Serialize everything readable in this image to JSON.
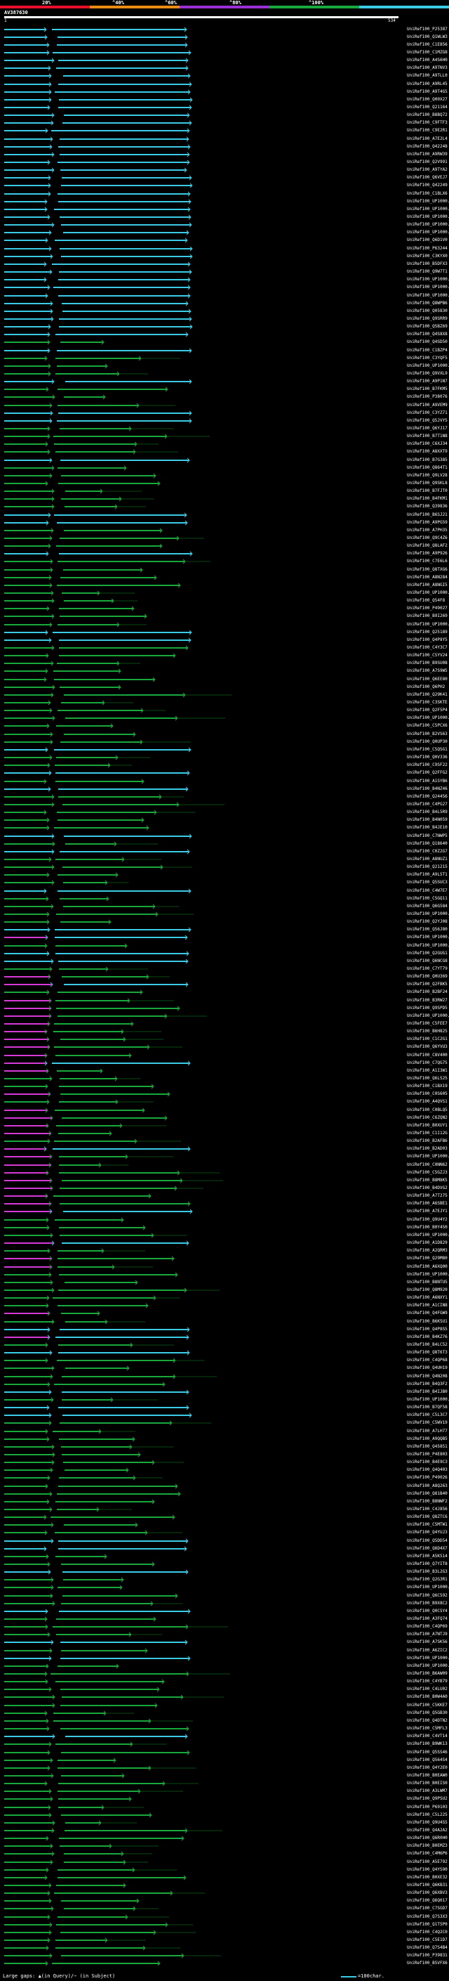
{
  "legend": {
    "ticks": [
      "20%",
      "^40%",
      "^60%",
      "^80%",
      "^100%"
    ],
    "colors": [
      "#e8102a",
      "#e98c14",
      "#9b2fd6",
      "#19a83b",
      "#3ccbe6"
    ]
  },
  "query": {
    "title": "AV387630",
    "start": "1",
    "end": "534"
  },
  "footer": {
    "large_gaps": "Large gaps: ▲(in Query)/− (in Subject)",
    "scale": "=100char."
  },
  "hits": [
    "UniRef100_P25387",
    "UniRef100_Q1WLW3",
    "UniRef100_C1E856",
    "UniRef100_C1MZG8",
    "UniRef100_A4S6H0",
    "UniRef100_A9TNV3",
    "UniRef100_A9TLL0",
    "UniRef100_A9RL45",
    "UniRef100_A9T4G5",
    "UniRef100_Q00X27",
    "UniRef100_Q21164",
    "UniRef100_B8BQ72",
    "UniRef100_C9FTF3",
    "UniRef100_C9E2R1",
    "UniRef100_A7E2L4",
    "UniRef100_Q42248",
    "UniRef100_A9RW39",
    "UniRef100_Q2V991",
    "UniRef100_A9TYA2",
    "UniRef100_Q6VEJ7",
    "UniRef100_Q42249",
    "UniRef100_C1BLX6",
    "UniRef100_UP1000..",
    "UniRef100_UP1000..",
    "UniRef100_UP1000..",
    "UniRef100_UP1000..",
    "UniRef100_UP1000..",
    "UniRef100_Q6D1V0",
    "UniRef100_P63244",
    "UniRef100_C3KYX0",
    "UniRef100_B5DFX3",
    "UniRef100_Q9W7T1",
    "UniRef100_UP1000..",
    "UniRef100_UP1000..",
    "UniRef100_UP1000..",
    "UniRef100_Q8WPB6",
    "UniRef100_Q05830",
    "UniRef100_Q9SRR9",
    "UniRef100_Q5BZ69",
    "UniRef100_Q4S8X8",
    "UniRef100_Q4SD50",
    "UniRef100_C1BZP4",
    "UniRef100_C3YQF5",
    "UniRef100_UP1000..",
    "UniRef100_Q9VXL9",
    "UniRef100_A9P1N7",
    "UniRef100_B7FKM5",
    "UniRef100_P38076",
    "UniRef100_A9VEM9",
    "UniRef100_C3YZ71",
    "UniRef100_Q5JVY5",
    "UniRef100_Q6YJ17",
    "UniRef100_B7T1N8",
    "UniRef100_C6XJ34",
    "UniRef100_A8XXT9",
    "UniRef100_B7G385",
    "UniRef100_Q864T1",
    "UniRef100_Q9LV28",
    "UniRef100_Q9SKL8",
    "UniRef100_B7FJT0",
    "UniRef100_B4FKM1",
    "UniRef100_Q39836",
    "UniRef100_B6SJ21",
    "UniRef100_A9PG59",
    "UniRef100_A7PH35",
    "UniRef100_Q9C4Z6",
    "UniRef100_Q8LAF2",
    "UniRef100_A9P926",
    "UniRef100_C7E6L6",
    "UniRef100_Q8TXG6",
    "UniRef100_A8N284",
    "UniRef100_A8NGI5",
    "UniRef100_UP1000..",
    "UniRef100_Q54F8",
    "UniRef100_P49027",
    "UniRef100_B9I269",
    "UniRef100_UP1000..",
    "UniRef100_Q25189",
    "UniRef100_Q4P8Y5",
    "UniRef100_C4Y3C7",
    "UniRef100_C5YV24",
    "UniRef100_B9SU08",
    "UniRef100_A7S9W5",
    "UniRef100_Q6EE80",
    "UniRef100_Q6PH2",
    "UniRef100_Q29K41",
    "UniRef100_C3SKTE",
    "UniRef100_Q2F5P4",
    "UniRef100_UP1000..",
    "UniRef100_C5PCX6",
    "UniRef100_B2VS63",
    "UniRef100_Q0UP30",
    "UniRef100_C5QSG1",
    "UniRef100_Q0V336",
    "UniRef100_C9SF22",
    "UniRef100_Q2FFG2",
    "UniRef100_A1SYB6",
    "UniRef100_B4NZ46",
    "UniRef100_Q24456",
    "UniRef100_C4PG27",
    "UniRef100_B4L5R9",
    "UniRef100_B4N059",
    "UniRef100_B4JE10",
    "UniRef100_C7NWP5",
    "UniRef100_Q18640",
    "UniRef100_C0Z2G7",
    "UniRef100_A8NUZ1",
    "UniRef100_Q21215",
    "UniRef100_A9LST1",
    "UniRef100_Q5SUC3",
    "UniRef100_C4W7E7",
    "UniRef100_C5GQ11",
    "UniRef100_Q6G584",
    "UniRef100_UP1000..",
    "UniRef100_Q2YJ08",
    "UniRef100_Q56J80",
    "UniRef100_UP1000..",
    "UniRef100_UP1000..",
    "UniRef100_Q2GUG1",
    "UniRef100_Q6NCG8",
    "UniRef100_C7YT79",
    "UniRef100_Q0U369",
    "UniRef100_Q2FBK5",
    "UniRef100_B2BF24",
    "UniRef100_B3RW27",
    "UniRef100_Q9SPD5",
    "UniRef100_UP1000..",
    "UniRef100_C5FEE7",
    "UniRef100_B6H825",
    "UniRef100_C1C2G1",
    "UniRef100_Q6YVU3",
    "UniRef100_C8V400",
    "UniRef100_C7QG75",
    "UniRef100_A1I3W1",
    "UniRef100_Q6LS25",
    "UniRef100_C1BX19",
    "UniRef100_C0S605",
    "UniRef100_A4QVS1",
    "UniRef100_C0BLQ5",
    "UniRef100_C6ZQN2",
    "UniRef100_B0XUY1",
    "UniRef100_C1I12G",
    "UniRef100_B2AFB6",
    "UniRef100_B2AD03",
    "UniRef100_UP1000..",
    "UniRef100_C0NN62",
    "UniRef100_C5GZJ3",
    "UniRef100_B8M8K5",
    "UniRef100_B4DVG2",
    "UniRef100_A7T275",
    "UniRef100_A6SBE1",
    "UniRef100_A7EJY1",
    "UniRef100_Q9U4Y2",
    "UniRef100_B0Y450",
    "UniRef100_UP1000..",
    "UniRef100_A1D829",
    "UniRef100_A2QRM3",
    "UniRef100_Q29M80",
    "UniRef100_A6XQ00",
    "UniRef100_UP1000..",
    "UniRef100_B8NTU5",
    "UniRef100_Q8M920",
    "UniRef100_A6NXY1",
    "UniRef100_A1CIN8",
    "UniRef100_Q4FGW9",
    "UniRef100_B6K5U1",
    "UniRef100_Q4P8S5",
    "UniRef100_B4KZ76",
    "UniRef100_B4LC52",
    "UniRef100_Q8T6T3",
    "UniRef100_C4QP68",
    "UniRef100_Q4UH19",
    "UniRef100_Q4N208",
    "UniRef100_B4Q3F2",
    "UniRef100_B4IJB0",
    "UniRef100_UP1000..",
    "UniRef100_B7QF58",
    "UniRef100_C5L3C7",
    "UniRef100_C5WV19",
    "UniRef100_A7LH77",
    "UniRef100_A9QQB5",
    "UniRef100_Q45851",
    "UniRef100_P4E803",
    "UniRef100_B4E9C3",
    "UniRef100_Q4Q403",
    "UniRef100_P49026",
    "UniRef100_A8Q263",
    "UniRef100_Q81B40",
    "UniRef100_B8NWF2",
    "UniRef100_C4J856",
    "UniRef100_Q8ZTC6",
    "UniRef100_C5MTW1",
    "UniRef100_Q4YUJ3",
    "UniRef100_Q5DD54",
    "UniRef100_Q6D4X7",
    "UniRef100_A5K514",
    "UniRef100_Q7YIT8",
    "UniRef100_B3L2G3",
    "UniRef100_Q2G3R1",
    "UniRef100_UP1000..",
    "UniRef100_Q6C592",
    "UniRef100_B9X8C2",
    "UniRef100_Q0CSY4",
    "UniRef100_A3FQ74",
    "UniRef100_C4QP69",
    "UniRef100_A7NTJ9",
    "UniRef100_A7SK56",
    "UniRef100_A6ZIC2",
    "UniRef100_UP1000..",
    "UniRef100_UP1000..",
    "UniRef100_B6AW09",
    "UniRef100_C4YB79",
    "UniRef100_C4LU02",
    "UniRef100_B0W4A0",
    "UniRef100_C5KKE7",
    "UniRef100_Q5GB30",
    "UniRef100_Q4DTN2",
    "UniRef100_C5MFL3",
    "UniRef100_C4VT14",
    "UniRef100_B9WK13",
    "UniRef100_Q5SS46",
    "UniRef100_Q564S4",
    "UniRef100_Q4Y2E0",
    "UniRef100_B0EAW0",
    "UniRef100_B0EIS0",
    "UniRef100_A3LWM7",
    "UniRef100_Q9PSU2",
    "UniRef100_P69103",
    "UniRef100_C5L225",
    "UniRef100_Q9U4S5",
    "UniRef100_Q4A2A2",
    "UniRef100_Q6R0H0",
    "UniRef100_B0EMZ3",
    "UniRef100_C4M6P6",
    "UniRef100_A5E792",
    "UniRef100_Q4YS90",
    "UniRef100_B0XE32",
    "UniRef100_Q6KB31",
    "UniRef100_Q6XBV3",
    "UniRef100_Q6Q017",
    "UniRef100_C7SGD7",
    "UniRef100_Q7S3X3",
    "UniRef100_Q1T5P0",
    "UniRef100_C4Q2C0",
    "UniRef100_C5E1D7",
    "UniRef100_Q7S4B4",
    "UniRef100_P39831",
    "UniRef100_B5VFX6"
  ]
}
